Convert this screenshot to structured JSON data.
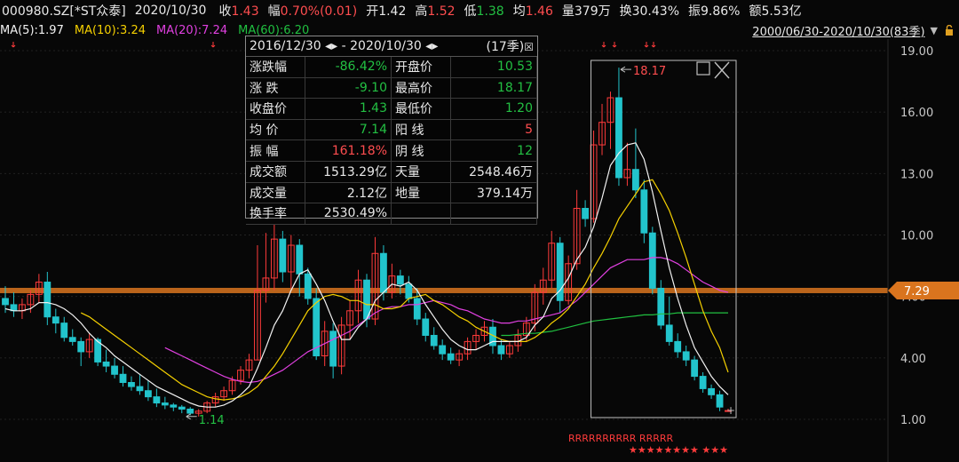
{
  "header": {
    "code": "000980.SZ[*ST众泰]",
    "date": "2020/10/30",
    "close": {
      "label": "收",
      "value": "1.43"
    },
    "change": {
      "label": "幅",
      "value": "0.70%(0.01)"
    },
    "open": {
      "label": "开",
      "value": "1.42"
    },
    "high": {
      "label": "高",
      "value": "1.52"
    },
    "low": {
      "label": "低",
      "value": "1.38"
    },
    "avg": {
      "label": "均",
      "value": "1.46"
    },
    "volume": {
      "label": "量",
      "value": "379万"
    },
    "turnover": {
      "label": "换",
      "value": "30.43%"
    },
    "amplitude": {
      "label": "振",
      "value": "9.86%"
    },
    "amount": {
      "label": "额",
      "value": "5.53亿"
    }
  },
  "ma_legend": [
    {
      "text": "MA(5):1.97",
      "color": "#f2f2f2"
    },
    {
      "text": "MA(10):3.24",
      "color": "#f5d000"
    },
    {
      "text": "MA(20):7.24",
      "color": "#e040e0"
    },
    {
      "text": "MA(60):6.20",
      "color": "#20c040"
    }
  ],
  "range_selector": {
    "text": "2000/06/30-2020/10/30(83季)",
    "icon": "chevron-down-icon",
    "lock_icon": "lock-icon"
  },
  "stats_box": {
    "range": "2016/12/30 ◂▸ - 2020/10/30 ◂▸",
    "periods": "(17季)",
    "rows": [
      [
        {
          "l": "涨跌幅",
          "v": "-86.42%",
          "c": "green"
        },
        {
          "l": "开盘价",
          "v": "10.53",
          "c": "green"
        }
      ],
      [
        {
          "l": "涨 跌",
          "v": "-9.10",
          "c": "green"
        },
        {
          "l": "最高价",
          "v": "18.17",
          "c": "green"
        }
      ],
      [
        {
          "l": "收盘价",
          "v": "1.43",
          "c": "green"
        },
        {
          "l": "最低价",
          "v": "1.20",
          "c": "green"
        }
      ],
      [
        {
          "l": "均 价",
          "v": "7.14",
          "c": "green"
        },
        {
          "l": "阳 线",
          "v": "5",
          "c": "red"
        }
      ],
      [
        {
          "l": "振 幅",
          "v": "161.18%",
          "c": "red"
        },
        {
          "l": "阴 线",
          "v": "12",
          "c": "green"
        }
      ],
      [
        {
          "l": "成交额",
          "v": "1513.29亿",
          "c": ""
        },
        {
          "l": "天量",
          "v": "2548.46万",
          "c": ""
        }
      ],
      [
        {
          "l": "成交量",
          "v": "2.12亿",
          "c": ""
        },
        {
          "l": "地量",
          "v": "379.14万",
          "c": ""
        }
      ],
      [
        {
          "l": "换手率",
          "v": "2530.49%",
          "c": ""
        },
        {
          "l": "",
          "v": "",
          "c": ""
        }
      ]
    ]
  },
  "chart_data": {
    "type": "candlestick",
    "y_ticks": [
      "19.00",
      "16.00",
      "13.00",
      "10.00",
      "7.00",
      "4.00",
      "1.00"
    ],
    "ylim": [
      0.3,
      19.8
    ],
    "current_price": "7.29",
    "high_marker": "18.17",
    "low_marker": "1.14",
    "colors": {
      "up": "#ff3b3b",
      "down": "#22c4cc",
      "ma5": "#f2f2f2",
      "ma10": "#f5d000",
      "ma20": "#e040e0",
      "ma60": "#20c040",
      "price_line": "#d9741e"
    },
    "candles": [
      [
        6.9,
        7.5,
        6.2,
        6.6
      ],
      [
        6.6,
        7.2,
        6.0,
        6.3
      ],
      [
        6.3,
        6.9,
        5.9,
        6.6
      ],
      [
        6.6,
        7.3,
        6.2,
        7.1
      ],
      [
        7.1,
        8.1,
        6.7,
        7.7
      ],
      [
        7.7,
        8.2,
        5.6,
        6.0
      ],
      [
        6.0,
        6.4,
        5.2,
        5.7
      ],
      [
        5.7,
        6.0,
        4.8,
        5.0
      ],
      [
        5.0,
        5.4,
        4.6,
        4.8
      ],
      [
        4.8,
        5.0,
        3.6,
        4.3
      ],
      [
        4.3,
        5.2,
        4.0,
        4.9
      ],
      [
        4.9,
        5.0,
        3.6,
        3.8
      ],
      [
        3.8,
        4.4,
        3.3,
        3.6
      ],
      [
        3.6,
        4.0,
        3.0,
        3.2
      ],
      [
        3.2,
        3.6,
        2.6,
        2.8
      ],
      [
        2.8,
        3.1,
        2.4,
        2.6
      ],
      [
        2.6,
        3.2,
        2.2,
        2.4
      ],
      [
        2.4,
        2.9,
        1.9,
        2.1
      ],
      [
        2.1,
        2.5,
        1.6,
        1.8
      ],
      [
        1.8,
        2.1,
        1.5,
        1.7
      ],
      [
        1.7,
        1.8,
        1.4,
        1.6
      ],
      [
        1.6,
        1.7,
        1.3,
        1.5
      ],
      [
        1.5,
        1.6,
        1.2,
        1.3
      ],
      [
        1.3,
        1.5,
        1.14,
        1.4
      ],
      [
        1.4,
        1.9,
        1.3,
        1.8
      ],
      [
        1.8,
        2.3,
        1.6,
        2.1
      ],
      [
        2.1,
        2.6,
        1.9,
        2.4
      ],
      [
        2.4,
        3.1,
        2.2,
        2.9
      ],
      [
        2.9,
        3.6,
        2.7,
        3.4
      ],
      [
        3.4,
        4.2,
        3.0,
        3.9
      ],
      [
        3.9,
        9.5,
        3.9,
        7.3
      ],
      [
        7.3,
        10.1,
        6.7,
        7.9
      ],
      [
        7.9,
        10.5,
        7.3,
        9.8
      ],
      [
        9.8,
        10.2,
        7.7,
        8.2
      ],
      [
        8.2,
        10.0,
        7.4,
        9.5
      ],
      [
        9.5,
        9.8,
        7.0,
        8.1
      ],
      [
        8.1,
        8.4,
        6.6,
        6.9
      ],
      [
        6.9,
        7.4,
        3.9,
        4.1
      ],
      [
        4.1,
        5.8,
        3.6,
        5.3
      ],
      [
        5.3,
        5.7,
        3.0,
        3.6
      ],
      [
        3.6,
        6.0,
        3.2,
        5.6
      ],
      [
        5.6,
        6.8,
        4.9,
        6.3
      ],
      [
        6.3,
        8.3,
        5.7,
        7.8
      ],
      [
        7.8,
        8.1,
        5.5,
        5.9
      ],
      [
        5.9,
        9.9,
        5.6,
        9.1
      ],
      [
        9.1,
        9.5,
        6.8,
        7.2
      ],
      [
        7.2,
        8.6,
        6.9,
        8.0
      ],
      [
        8.0,
        8.3,
        7.1,
        7.6
      ],
      [
        7.6,
        8.0,
        6.7,
        6.9
      ],
      [
        6.9,
        7.4,
        5.6,
        5.9
      ],
      [
        5.9,
        6.2,
        4.8,
        5.1
      ],
      [
        5.1,
        5.5,
        4.4,
        4.6
      ],
      [
        4.6,
        4.9,
        3.9,
        4.2
      ],
      [
        4.2,
        4.5,
        3.7,
        3.9
      ],
      [
        3.9,
        4.4,
        3.6,
        4.2
      ],
      [
        4.2,
        5.0,
        3.9,
        4.8
      ],
      [
        4.8,
        5.4,
        4.4,
        5.1
      ],
      [
        5.1,
        5.8,
        4.8,
        5.5
      ],
      [
        5.5,
        5.9,
        4.2,
        4.6
      ],
      [
        4.6,
        4.9,
        3.9,
        4.2
      ],
      [
        4.2,
        4.8,
        4.0,
        4.6
      ],
      [
        4.6,
        5.4,
        4.3,
        5.1
      ],
      [
        5.1,
        6.0,
        4.8,
        5.7
      ],
      [
        5.7,
        7.6,
        5.3,
        7.2
      ],
      [
        7.2,
        8.4,
        6.6,
        7.8
      ],
      [
        7.8,
        10.2,
        7.4,
        9.6
      ],
      [
        9.6,
        9.9,
        6.2,
        6.8
      ],
      [
        6.8,
        9.0,
        6.6,
        8.6
      ],
      [
        8.6,
        12.2,
        8.3,
        11.3
      ],
      [
        11.3,
        11.7,
        10.4,
        10.8
      ],
      [
        10.8,
        15.1,
        10.6,
        14.4
      ],
      [
        14.4,
        16.4,
        13.9,
        15.5
      ],
      [
        15.5,
        17.0,
        14.2,
        16.7
      ],
      [
        16.7,
        18.17,
        12.4,
        12.8
      ],
      [
        12.8,
        14.5,
        12.4,
        13.2
      ],
      [
        13.2,
        15.2,
        11.8,
        12.2
      ],
      [
        12.2,
        12.7,
        9.6,
        10.1
      ],
      [
        10.1,
        10.4,
        7.1,
        7.4
      ],
      [
        7.4,
        7.8,
        5.4,
        5.6
      ],
      [
        5.6,
        7.0,
        4.6,
        4.8
      ],
      [
        4.8,
        5.2,
        4.0,
        4.3
      ],
      [
        4.3,
        4.6,
        3.6,
        3.9
      ],
      [
        3.9,
        4.1,
        2.9,
        3.1
      ],
      [
        3.1,
        3.3,
        2.3,
        2.5
      ],
      [
        2.5,
        2.7,
        2.0,
        2.2
      ],
      [
        2.2,
        2.4,
        1.4,
        1.6
      ],
      [
        1.42,
        1.52,
        1.38,
        1.43
      ]
    ],
    "ma5": [
      6.4,
      6.3,
      6.3,
      6.4,
      6.7,
      6.7,
      6.6,
      6.4,
      6.1,
      5.7,
      5.2,
      4.8,
      4.5,
      4.1,
      3.8,
      3.5,
      3.2,
      2.9,
      2.6,
      2.4,
      2.2,
      2.0,
      1.8,
      1.65,
      1.6,
      1.6,
      1.7,
      1.9,
      2.2,
      2.6,
      3.5,
      4.5,
      5.6,
      6.3,
      7.3,
      8.1,
      8.3,
      7.6,
      6.8,
      5.8,
      4.9,
      4.9,
      5.5,
      5.9,
      6.8,
      7.2,
      7.6,
      7.5,
      7.7,
      7.3,
      6.6,
      6.0,
      5.4,
      4.9,
      4.6,
      4.4,
      4.4,
      4.6,
      4.8,
      4.8,
      4.8,
      4.8,
      5.0,
      5.6,
      6.0,
      6.9,
      7.3,
      7.9,
      8.8,
      9.4,
      10.4,
      11.8,
      13.4,
      14.0,
      14.4,
      14.5,
      13.7,
      12.1,
      10.2,
      8.4,
      6.9,
      5.6,
      4.5,
      3.8,
      3.1,
      2.6,
      2.2
    ],
    "ma10": [
      null,
      null,
      null,
      null,
      null,
      null,
      null,
      null,
      null,
      6.2,
      6.0,
      5.7,
      5.4,
      5.1,
      4.8,
      4.5,
      4.2,
      3.9,
      3.6,
      3.3,
      3.0,
      2.7,
      2.5,
      2.3,
      2.1,
      2.0,
      1.95,
      2.0,
      2.1,
      2.3,
      2.6,
      3.1,
      3.6,
      4.2,
      4.9,
      5.6,
      6.3,
      6.7,
      7.0,
      7.1,
      7.0,
      6.8,
      6.8,
      6.6,
      6.6,
      6.4,
      6.4,
      6.5,
      6.9,
      7.0,
      7.1,
      6.8,
      6.6,
      6.3,
      6.0,
      5.8,
      5.5,
      5.3,
      5.1,
      4.9,
      4.8,
      4.8,
      4.8,
      5.0,
      5.3,
      5.7,
      6.0,
      6.4,
      7.0,
      7.6,
      8.4,
      9.1,
      9.9,
      10.8,
      11.4,
      12.0,
      12.6,
      12.7,
      12.0,
      11.2,
      10.1,
      8.9,
      7.6,
      6.3,
      5.3,
      4.5,
      3.3
    ],
    "ma20": [
      null,
      null,
      null,
      null,
      null,
      null,
      null,
      null,
      null,
      null,
      null,
      null,
      null,
      null,
      null,
      null,
      null,
      null,
      null,
      4.5,
      4.3,
      4.1,
      3.9,
      3.7,
      3.5,
      3.3,
      3.1,
      2.95,
      2.85,
      2.8,
      2.85,
      3.0,
      3.2,
      3.4,
      3.7,
      4.0,
      4.3,
      4.5,
      4.7,
      4.9,
      5.1,
      5.3,
      5.6,
      5.9,
      6.2,
      6.4,
      6.5,
      6.5,
      6.6,
      6.6,
      6.7,
      6.8,
      6.7,
      6.6,
      6.4,
      6.3,
      6.1,
      5.9,
      5.8,
      5.7,
      5.7,
      5.8,
      5.8,
      5.9,
      6.0,
      6.1,
      6.2,
      6.5,
      6.8,
      7.2,
      7.6,
      8.0,
      8.4,
      8.6,
      8.8,
      8.8,
      8.8,
      8.9,
      8.9,
      8.8,
      8.6,
      8.3,
      8.0,
      7.7,
      7.5,
      7.3,
      7.2
    ],
    "ma60": [
      null,
      null,
      null,
      null,
      null,
      null,
      null,
      null,
      null,
      null,
      null,
      null,
      null,
      null,
      null,
      null,
      null,
      null,
      null,
      null,
      null,
      null,
      null,
      null,
      null,
      null,
      null,
      null,
      null,
      null,
      null,
      null,
      null,
      null,
      null,
      null,
      null,
      null,
      null,
      null,
      null,
      null,
      null,
      null,
      null,
      null,
      null,
      null,
      null,
      null,
      null,
      null,
      null,
      null,
      null,
      null,
      null,
      null,
      null,
      5.1,
      5.1,
      5.15,
      5.2,
      5.2,
      5.25,
      5.3,
      5.4,
      5.5,
      5.6,
      5.7,
      5.8,
      5.85,
      5.9,
      5.95,
      6.0,
      6.05,
      6.1,
      6.1,
      6.15,
      6.15,
      6.2,
      6.2,
      6.2,
      6.2,
      6.2,
      6.2,
      6.2
    ],
    "r_marker_text": "RRRRRRRRRR RRRRR",
    "star_marker_text": "★★★★★★★★ ★★★"
  }
}
